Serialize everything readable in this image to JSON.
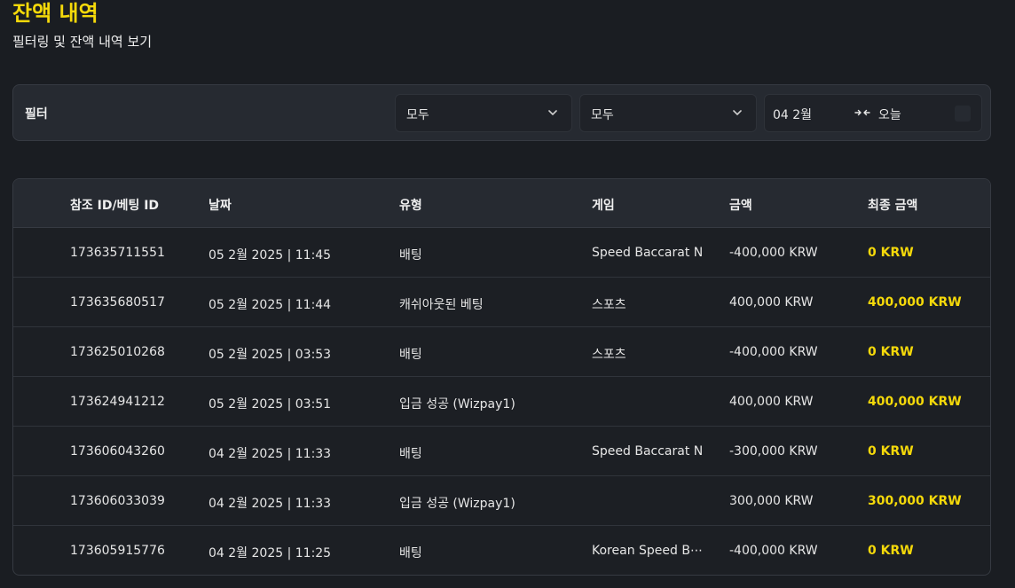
{
  "header": {
    "title": "잔액 내역",
    "subtitle": "필터링 및 잔액 내역 보기"
  },
  "filter": {
    "label": "필터",
    "type_select": {
      "value": "모두"
    },
    "game_select": {
      "value": "모두"
    },
    "date_range": {
      "from": "04 2월",
      "to": "오늘"
    }
  },
  "table": {
    "columns": [
      "참조 ID/베팅 ID",
      "날짜",
      "유형",
      "게임",
      "금액",
      "최종 금액"
    ],
    "rows": [
      {
        "ref_id": "173635711551",
        "date": "05 2월 2025 | 11:45",
        "type": "배팅",
        "game": "Speed Baccarat N",
        "amount": "-400,000 KRW",
        "final": "0 KRW"
      },
      {
        "ref_id": "173635680517",
        "date": "05 2월 2025 | 11:44",
        "type": "캐쉬아웃된 베팅",
        "game": "스포츠",
        "amount": "400,000 KRW",
        "final": "400,000 KRW"
      },
      {
        "ref_id": "173625010268",
        "date": "05 2월 2025 | 03:53",
        "type": "배팅",
        "game": "스포츠",
        "amount": "-400,000 KRW",
        "final": "0 KRW"
      },
      {
        "ref_id": "173624941212",
        "date": "05 2월 2025 | 03:51",
        "type": "입금 성공 (Wizpay1)",
        "game": "",
        "amount": "400,000 KRW",
        "final": "400,000 KRW"
      },
      {
        "ref_id": "173606043260",
        "date": "04 2월 2025 | 11:33",
        "type": "배팅",
        "game": "Speed Baccarat N",
        "amount": "-300,000 KRW",
        "final": "0 KRW"
      },
      {
        "ref_id": "173606033039",
        "date": "04 2월 2025 | 11:33",
        "type": "입금 성공 (Wizpay1)",
        "game": "",
        "amount": "300,000 KRW",
        "final": "300,000 KRW"
      },
      {
        "ref_id": "173605915776",
        "date": "04 2월 2025 | 11:25",
        "type": "배팅",
        "game": "Korean Speed B⋯",
        "amount": "-400,000 KRW",
        "final": "0 KRW"
      }
    ]
  },
  "icons": {
    "select_chevron": "chevron-down-icon",
    "range_arrow": "range-arrows-icon",
    "calendar": "calendar-icon"
  },
  "colors": {
    "accent": "#f5d90a",
    "background": "#1a1d22",
    "panel": "#262a31"
  }
}
